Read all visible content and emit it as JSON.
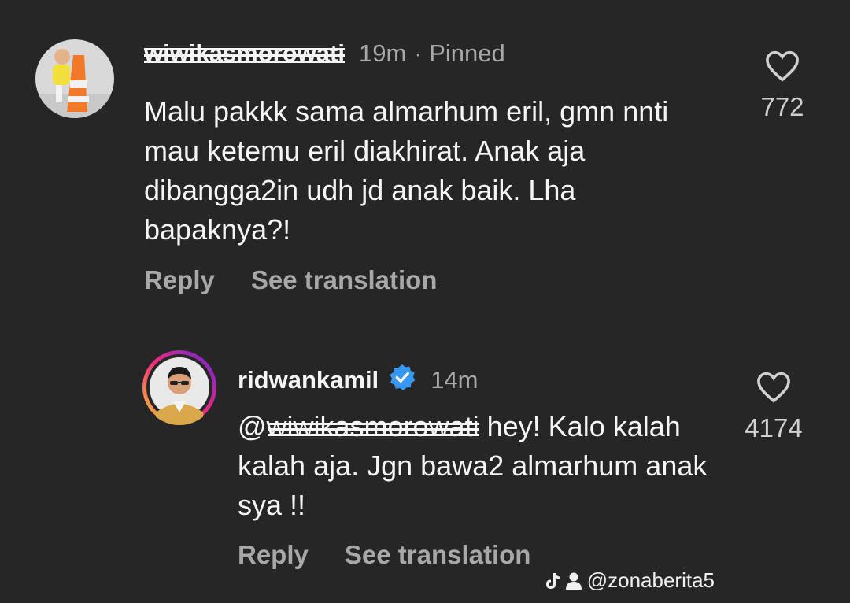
{
  "comments": [
    {
      "username": "wiwikasmorowati",
      "time": "19m",
      "pinned_label": "· Pinned",
      "text": "Malu pakkk sama almarhum eril, gmn nnti mau ketemu eril diakhirat. Anak aja dibangga2in udh jd anak baik. Lha bapaknya?!",
      "likes": "772",
      "reply_label": "Reply",
      "translation_label": "See translation"
    },
    {
      "username": "ridwankamil",
      "verified": true,
      "time": "14m",
      "mention": "@wiwikasmorowati",
      "text": " hey! Kalo kalah kalah aja. Jgn bawa2 almarhum anak sya !!",
      "likes": "4174",
      "reply_label": "Reply",
      "translation_label": "See translation"
    }
  ],
  "watermark": {
    "handle": "@zonaberita5",
    "icons": [
      "tiktok-icon",
      "user-icon"
    ]
  },
  "colors": {
    "background": "#262626",
    "text": "#f5f5f5",
    "muted": "#a8a8a8",
    "verified": "#3897f0",
    "story_ring": [
      "#f9ce34",
      "#ee2a7b",
      "#6228d7"
    ]
  }
}
